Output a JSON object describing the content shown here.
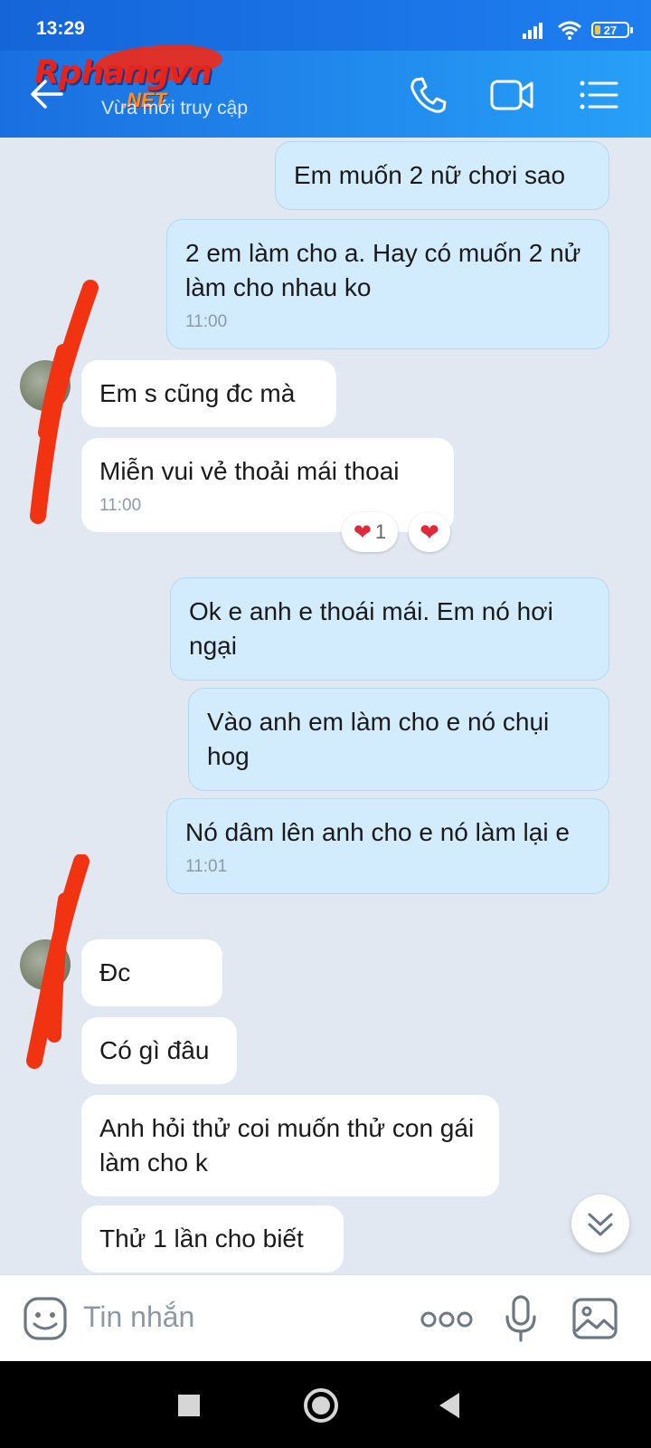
{
  "status": {
    "time": "13:29",
    "battery": "27"
  },
  "header": {
    "logo_main": "Rphangvn",
    "logo_net": ".NET",
    "subtitle": "Vừa mới truy cập"
  },
  "messages": [
    {
      "text": "Em muốn 2 nữ chơi sao",
      "time": ""
    },
    {
      "text": "2 em làm cho a. Hay  có muốn 2 nử làm cho nhau ko",
      "time": "11:00"
    },
    {
      "text": "Em s cũng đc mà",
      "time": ""
    },
    {
      "text": "Miễn vui vẻ thoải mái thoai",
      "time": "11:00",
      "reaction_count": "1"
    },
    {
      "text": "Ok e anh e thoái mái. Em nó hơi ngại",
      "time": ""
    },
    {
      "text": "Vào anh em làm cho e nó chụi hog",
      "time": ""
    },
    {
      "text": "Nó dâm lên anh cho e nó làm lại e",
      "time": "11:01"
    },
    {
      "text": "Đc",
      "time": ""
    },
    {
      "text": "Có gì đâu",
      "time": ""
    },
    {
      "text": "Anh hỏi thử coi muốn thử con gái làm cho k",
      "time": ""
    },
    {
      "text": "Thử 1 lần cho biết",
      "time": ""
    }
  ],
  "composer": {
    "placeholder": "Tin nhắn"
  },
  "icons": {
    "back": "arrow-left-icon",
    "call": "phone-icon",
    "video": "video-call-icon",
    "menu": "list-menu-icon",
    "emoji": "sticker-icon",
    "more": "more-dots-icon",
    "mic": "microphone-icon",
    "gallery": "image-icon",
    "scroll": "chevrons-down-icon",
    "reaction": "heart-icon"
  },
  "colors": {
    "header": "#1e7ff0",
    "my_bubble": "#d3ecfd",
    "their_bubble": "#ffffff",
    "chat_bg": "#e2e8f1",
    "scribble": "#f13311"
  }
}
